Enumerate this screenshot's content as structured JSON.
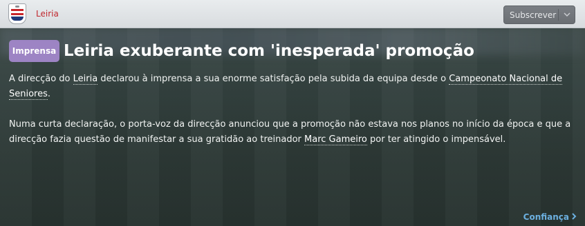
{
  "header": {
    "club_name": "Leiria",
    "subscribe_label": "Subscrever",
    "crest_icon": "club-crest-icon"
  },
  "article": {
    "tag": "Imprensa",
    "tag_color": "#9d84c4",
    "title": "Leiria exuberante com 'inesperada' promoção",
    "p1_before": "A direcção do ",
    "p1_link1": "Leiria",
    "p1_middle": " declarou à imprensa a sua enorme satisfação pela subida da equipa desde o ",
    "p1_link2": "Campeonato Nacional de Seniores",
    "p1_after": ".",
    "p2_before": "Numa curta declaração, o porta-voz da direcção anunciou que a promoção não estava nos planos no início da época e que a direcção fazia questão de manifestar a sua gratidão ao treinador ",
    "p2_link": "Marc Gameiro",
    "p2_after": " por ter atingido o impensável."
  },
  "footer": {
    "link_label": "Confiança",
    "link_color": "#6cb0e0"
  }
}
